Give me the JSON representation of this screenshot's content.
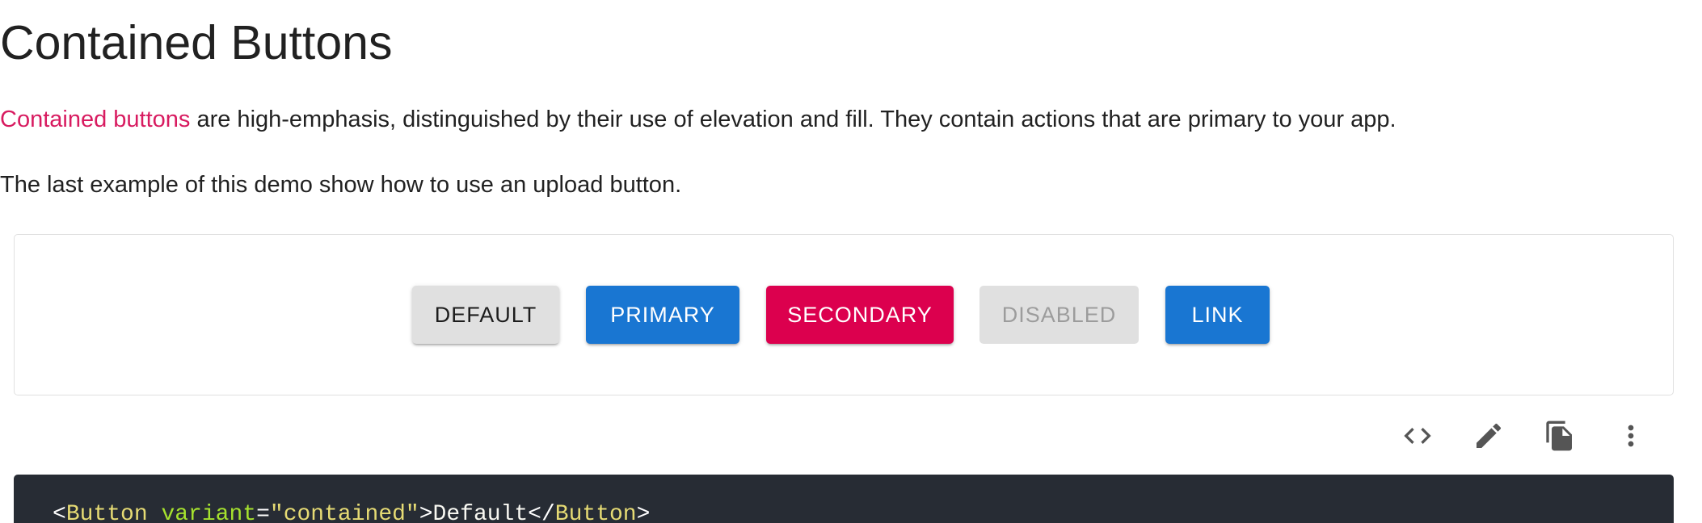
{
  "header": {
    "title": "Contained Buttons"
  },
  "intro": {
    "link_text": "Contained buttons",
    "rest": " are high-emphasis, distinguished by their use of elevation and fill. They contain actions that are primary to your app."
  },
  "note": "The last example of this demo show how to use an upload button.",
  "demo": {
    "buttons": [
      {
        "label": "DEFAULT",
        "variant": "default",
        "color": "#e0e0e0"
      },
      {
        "label": "PRIMARY",
        "variant": "primary",
        "color": "#1976d2"
      },
      {
        "label": "SECONDARY",
        "variant": "secondary",
        "color": "#dc004e"
      },
      {
        "label": "DISABLED",
        "variant": "disabled",
        "color": "#e0e0e0"
      },
      {
        "label": "LINK",
        "variant": "link",
        "color": "#1976d2"
      }
    ]
  },
  "toolbar": {
    "icons": [
      "code-icon",
      "edit-icon",
      "copy-icon",
      "more-vert-icon"
    ]
  },
  "code": {
    "open_bracket": "<",
    "tag": "Button",
    "attr_name": "variant",
    "equals": "=",
    "attr_value": "\"contained\"",
    "close_bracket": ">",
    "text": "Default",
    "end_open": "</",
    "end_tag": "Button",
    "end_close": ">"
  },
  "colors": {
    "link": "#d81b60",
    "primary": "#1976d2",
    "secondary": "#dc004e",
    "code_bg": "#272c34"
  }
}
